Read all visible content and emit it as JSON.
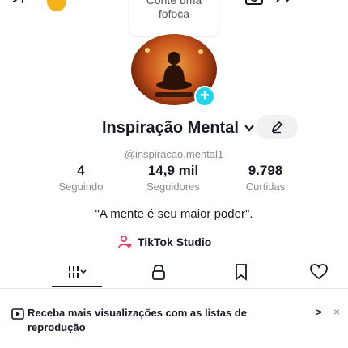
{
  "story": {
    "line1": "Conte uma",
    "line2": "fofoca"
  },
  "profile": {
    "name": "Inspiração Mental",
    "handle": "@inspiracao.mental1",
    "bio": "\"A mente é seu maior poder\"."
  },
  "stats": [
    {
      "value": "4",
      "label": "Seguindo"
    },
    {
      "value": "14,9 mil",
      "label": "Seguidores"
    },
    {
      "value": "9.798",
      "label": "Curtidas"
    }
  ],
  "studio": {
    "label": "TikTok Studio"
  },
  "tabs": [
    {
      "name": "videos",
      "icon": "grid-icon"
    },
    {
      "name": "private",
      "icon": "lock-icon"
    },
    {
      "name": "saved",
      "icon": "bookmark-icon"
    },
    {
      "name": "liked",
      "icon": "heart-icon"
    }
  ],
  "banner": {
    "text": "Receba mais visualizações com as listas de reprodução",
    "arrow": ">",
    "close": "×"
  },
  "colors": {
    "accent": "#20d5ec",
    "coin": "#f5b21a",
    "studio": "#fe2c55"
  }
}
